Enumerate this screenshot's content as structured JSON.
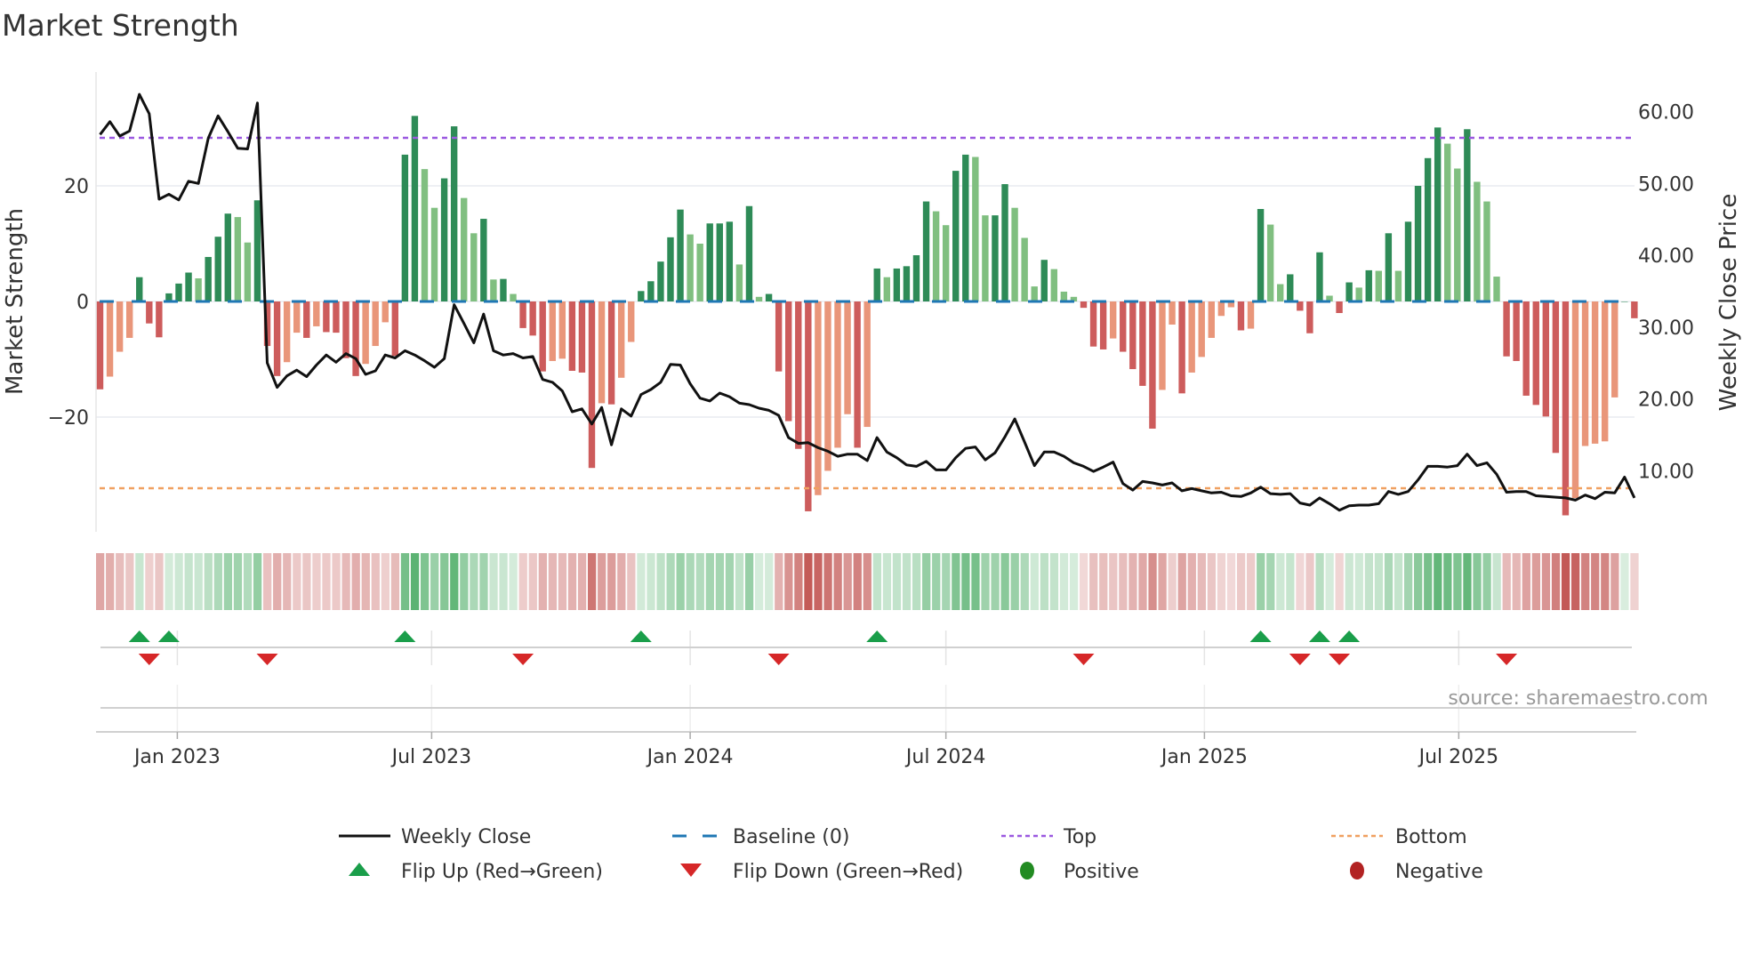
{
  "title": "Market Strength",
  "source": "source: sharemaestro.com",
  "colors": {
    "pos_rising": "#2e8b57",
    "pos_falling": "#80bf80",
    "neg_falling": "#cd5c5c",
    "neg_rising": "#e9967a",
    "baseline": "#1f77b4",
    "top": "#9b59e0",
    "bottom": "#f0a060",
    "close": "#111111",
    "flip_up": "#1a9e4a",
    "flip_down": "#d62728",
    "positive": "#228b22",
    "negative": "#b22222"
  },
  "legend": [
    {
      "label": "Weekly Close",
      "symbol": "line"
    },
    {
      "label": "Baseline (0)",
      "symbol": "dash"
    },
    {
      "label": "Top",
      "symbol": "dot-purple"
    },
    {
      "label": "Bottom",
      "symbol": "dot-orange"
    },
    {
      "label": "Flip Up (Red→Green)",
      "symbol": "triangle-up"
    },
    {
      "label": "Flip Down (Green→Red)",
      "symbol": "triangle-down"
    },
    {
      "label": "Positive",
      "symbol": "circle-green"
    },
    {
      "label": "Negative",
      "symbol": "circle-red"
    }
  ],
  "chart_data": {
    "type": "bar",
    "title": "Market Strength",
    "ylabel": "Market Strength",
    "y2label": "Weekly Close Price",
    "ylim": [
      -40,
      40
    ],
    "y2lim": [
      0,
      64
    ],
    "yticks": [
      {
        "v": 20,
        "label": "20"
      },
      {
        "v": 0,
        "label": "0"
      },
      {
        "v": -20,
        "label": "−20"
      }
    ],
    "y2ticks": [
      {
        "v": 60,
        "label": "60.00"
      },
      {
        "v": 50,
        "label": "50.00"
      },
      {
        "v": 40,
        "label": "40.00"
      },
      {
        "v": 30,
        "label": "30.00"
      },
      {
        "v": 20,
        "label": "20.00"
      },
      {
        "v": 10,
        "label": "10.00"
      }
    ],
    "xticks": [
      {
        "label": "Jan 2023",
        "date": "2023-01-01"
      },
      {
        "label": "Jul 2023",
        "date": "2023-07-01"
      },
      {
        "label": "Jan 2024",
        "date": "2024-01-01"
      },
      {
        "label": "Jul 2024",
        "date": "2024-07-01"
      },
      {
        "label": "Jan 2025",
        "date": "2025-01-01"
      },
      {
        "label": "Jul 2025",
        "date": "2025-07-01"
      }
    ],
    "start_date": "2022-11-07",
    "frequency": "weekly",
    "top_level": 28.3,
    "bottom_level": -32.3,
    "baseline": 0,
    "grid": true,
    "legend_position": "bottom",
    "strength": [
      -15.2,
      -13,
      -8.7,
      -6.3,
      4.2,
      -3.8,
      -6.2,
      1.4,
      3.1,
      5,
      4,
      7.7,
      11.2,
      15.2,
      14.6,
      10.2,
      17.5,
      -7.7,
      -12.9,
      -10.5,
      -5.4,
      -6.3,
      -4.3,
      -5.3,
      -5.4,
      -9.8,
      -12.9,
      -10.8,
      -7.7,
      -3.6,
      -9.4,
      25.4,
      32.1,
      22.9,
      16.2,
      21.3,
      30.3,
      17.9,
      11.8,
      14.3,
      3.8,
      3.9,
      1.3,
      -4.6,
      -5.9,
      -12.1,
      -10.3,
      -9.9,
      -12,
      -12.3,
      -28.8,
      -17.6,
      -17.8,
      -13.2,
      -7,
      1.8,
      3.5,
      6.9,
      11.1,
      15.9,
      11.6,
      10,
      13.5,
      13.5,
      13.8,
      6.4,
      16.5,
      0.8,
      1.3,
      -12.1,
      -20.7,
      -25.5,
      -36.3,
      -33.5,
      -29.3,
      -25.3,
      -19.5,
      -25.3,
      -21.7,
      5.7,
      4.2,
      5.7,
      6.1,
      8,
      17.3,
      15.6,
      13.2,
      22.6,
      25.4,
      25,
      14.9,
      14.9,
      20.3,
      16.2,
      11,
      2.6,
      7.2,
      5.6,
      1.7,
      0.8,
      -1.1,
      -7.8,
      -8.3,
      -6.4,
      -8.7,
      -11.7,
      -14.6,
      -22,
      -15.3,
      -4,
      -15.9,
      -12.3,
      -9.6,
      -6.3,
      -2.5,
      -1,
      -5,
      -4.7,
      16,
      13.3,
      3,
      4.7,
      -1.6,
      -5.5,
      8.5,
      1,
      -2,
      3.3,
      2.4,
      5.4,
      5.3,
      11.8,
      5.3,
      13.8,
      20,
      24.8,
      30.1,
      27.3,
      23,
      29.8,
      20.7,
      17.3,
      4.3,
      -9.5,
      -10.3,
      -16.3,
      -17.9,
      -19.9,
      -26.2,
      -37,
      -34,
      -25,
      -24.6,
      -24.2,
      -16.6,
      0,
      -2.9
    ],
    "weekly_close": [
      56.8,
      58.6,
      56.6,
      57.3,
      62.4,
      59.7,
      47.8,
      48.5,
      47.7,
      50.3,
      50,
      56.3,
      59.4,
      57.2,
      54.9,
      54.8,
      61.2,
      25,
      21.6,
      23.2,
      24,
      23.1,
      24.7,
      26.1,
      25.1,
      26.3,
      25.6,
      23.4,
      23.9,
      26.1,
      25.7,
      26.7,
      26.1,
      25.3,
      24.4,
      25.6,
      33.1,
      30.5,
      27.8,
      31.8,
      26.7,
      26.1,
      26.3,
      25.7,
      25.9,
      22.7,
      22.3,
      21.1,
      18.2,
      18.6,
      16.5,
      18.8,
      13.6,
      18.6,
      17.6,
      20.6,
      21.3,
      22.3,
      24.8,
      24.7,
      22.1,
      20.1,
      19.7,
      20.8,
      20.3,
      19.4,
      19.2,
      18.7,
      18.4,
      17.7,
      14.6,
      13.8,
      13.9,
      13.2,
      12.7,
      12,
      12.3,
      12.3,
      11.4,
      14.6,
      12.6,
      11.8,
      10.8,
      10.6,
      11.3,
      10.1,
      10.1,
      11.8,
      13.1,
      13.3,
      11.5,
      12.5,
      14.7,
      17.2,
      14,
      10.7,
      12.6,
      12.6,
      12,
      11.1,
      10.6,
      9.9,
      10.5,
      11.2,
      8.2,
      7.3,
      8.5,
      8.3,
      8,
      8.3,
      7.2,
      7.5,
      7.2,
      6.9,
      7,
      6.5,
      6.4,
      6.9,
      7.7,
      6.8,
      6.7,
      6.8,
      5.5,
      5.2,
      6.2,
      5.4,
      4.5,
      5.1,
      5.2,
      5.2,
      5.4,
      7.1,
      6.7,
      7.1,
      8.7,
      10.6,
      10.6,
      10.5,
      10.7,
      12.3,
      10.7,
      11.1,
      9.5,
      7,
      7.1,
      7.1,
      6.5,
      6.4,
      6.3,
      6.2,
      5.9,
      6.6,
      6.1,
      7,
      6.9,
      9.1,
      6.2
    ]
  }
}
